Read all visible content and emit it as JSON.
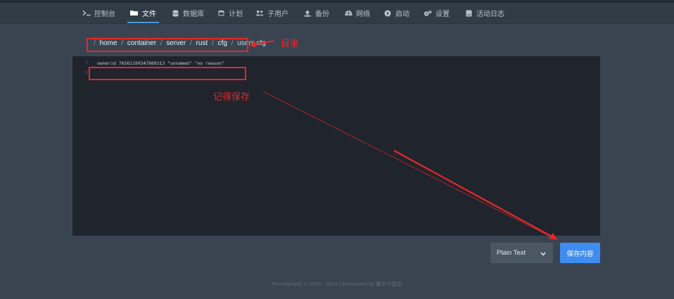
{
  "nav": {
    "items": [
      {
        "label": "控制台",
        "icon": "terminal-icon"
      },
      {
        "label": "文件",
        "icon": "folder-icon",
        "active": true
      },
      {
        "label": "数据库",
        "icon": "database-icon"
      },
      {
        "label": "计划",
        "icon": "calendar-icon"
      },
      {
        "label": "子用户",
        "icon": "users-icon"
      },
      {
        "label": "备份",
        "icon": "upload-icon"
      },
      {
        "label": "网络",
        "icon": "network-icon"
      },
      {
        "label": "启动",
        "icon": "play-icon"
      },
      {
        "label": "设置",
        "icon": "gears-icon"
      },
      {
        "label": "活动日志",
        "icon": "log-icon"
      }
    ]
  },
  "breadcrumb": {
    "separator": "/",
    "parts": [
      "home",
      "container",
      "server",
      "rust",
      "cfg"
    ],
    "file": "users.cfg"
  },
  "editor": {
    "lines": [
      {
        "num": "1",
        "text": "ownerid 76561199347869313 \"unnamed\" \"no reason\""
      },
      {
        "num": "2",
        "text": ""
      }
    ]
  },
  "controls": {
    "language": "Plain Text",
    "save_label": "保存内容"
  },
  "footer": {
    "text": "Pterodactyl® © 2015 - 2024 | Sinicizated by 翼龙中国志"
  },
  "annotations": {
    "directory_label": "目录",
    "remember_save_label": "记得保存",
    "color": "#e8262a"
  }
}
